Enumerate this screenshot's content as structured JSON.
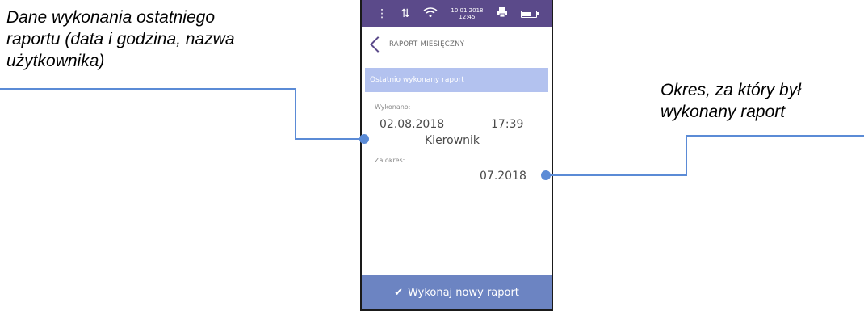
{
  "annotations": {
    "left": "Dane wykonania ostatniego\nraportu (data i godzina, nazwa\nużytkownika)",
    "right": "Okres, za który był\nwykonany raport"
  },
  "status_bar": {
    "date": "10.01.2018",
    "time": "12:45",
    "icons": [
      "menu-dots-icon",
      "data-transfer-icon",
      "wifi-icon",
      "printer-icon",
      "battery-icon"
    ],
    "bg_color": "#5b4a8a"
  },
  "screen": {
    "title": "RAPORT MIESIĘCZNY",
    "section_header": "Ostatnio wykonany raport",
    "executed_label": "Wykonano:",
    "executed_date": "02.08.2018",
    "executed_time": "17:39",
    "user": "Kierownik",
    "period_label": "Za okres:",
    "period_value": "07.2018",
    "action_button": "Wykonaj nowy raport"
  },
  "colors": {
    "accent": "#5b8bd6",
    "header": "#b3c2ef",
    "button": "#6c84c2"
  }
}
